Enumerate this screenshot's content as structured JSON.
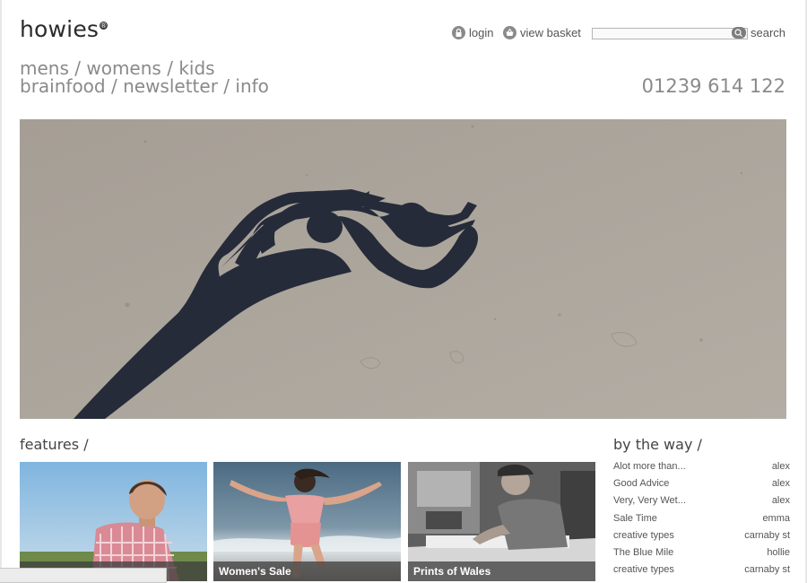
{
  "brand": {
    "name": "howies",
    "reg_mark": "®"
  },
  "utility": {
    "login_label": "login",
    "login_icon": "lock-icon",
    "basket_label": "view basket",
    "basket_icon": "basket-icon",
    "search_placeholder": "",
    "search_label": "search",
    "search_icon": "magnifier-icon"
  },
  "nav": {
    "row1": [
      "mens",
      "womens",
      "kids"
    ],
    "row2": [
      "brainfood",
      "newsletter",
      "info"
    ],
    "separator": "/"
  },
  "phone": "01239 614 122",
  "hero": {
    "subject": "shadow-on-sand-photo"
  },
  "features": {
    "title": "features /",
    "tiles": [
      {
        "caption": ""
      },
      {
        "caption": "Women's Sale"
      },
      {
        "caption": "Prints of Wales"
      }
    ]
  },
  "by_the_way": {
    "title": "by the way /",
    "items": [
      {
        "title": "Alot more than...",
        "author": "alex"
      },
      {
        "title": "Good Advice",
        "author": "alex"
      },
      {
        "title": "Very, Very Wet...",
        "author": "alex"
      },
      {
        "title": "Sale Time",
        "author": "emma"
      },
      {
        "title": "creative types",
        "author": "carnaby st"
      },
      {
        "title": "The Blue Mile",
        "author": "hollie"
      },
      {
        "title": "creative types",
        "author": "carnaby st"
      }
    ]
  },
  "colors": {
    "nav_grey": "#8a8a8a",
    "text_dark": "#2b2b2b",
    "sand": "#a9a299",
    "shadow": "#252a38"
  }
}
